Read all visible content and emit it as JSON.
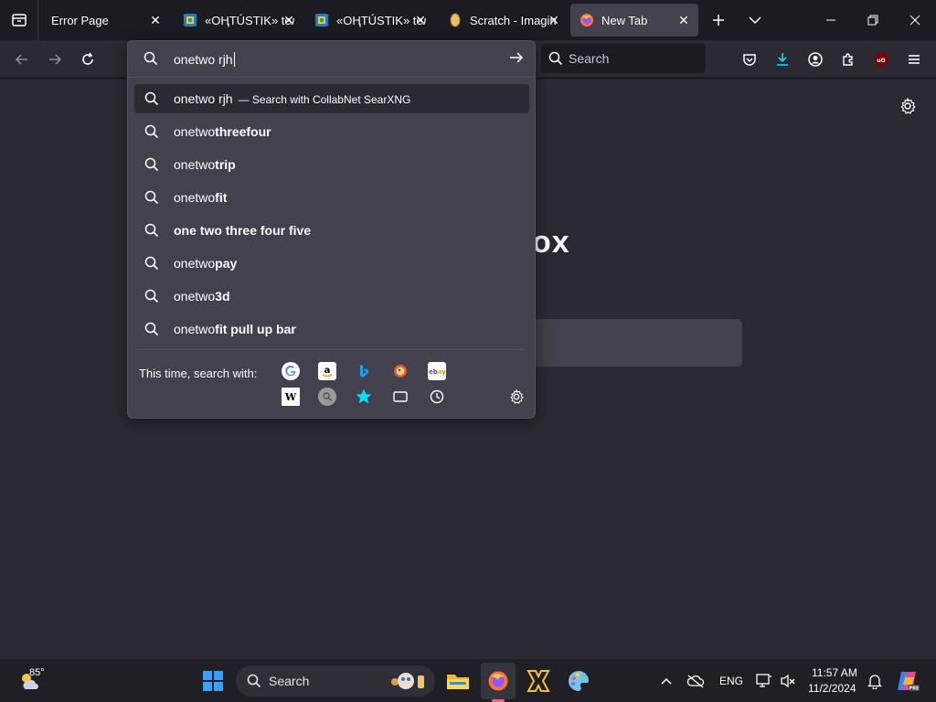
{
  "tabs": [
    {
      "title": "Error Page",
      "favicon": "none",
      "active": false
    },
    {
      "title": "«ОҢТÚSTIK» teл",
      "favicon": "site-icon",
      "active": false
    },
    {
      "title": "«ОҢТÚSTIK» teл",
      "favicon": "site-icon",
      "active": false
    },
    {
      "title": "Scratch - Imagin",
      "favicon": "scratch-icon",
      "active": false
    },
    {
      "title": "New Tab",
      "favicon": "firefox-icon",
      "active": true
    }
  ],
  "toolbar": {
    "search_label": "Search"
  },
  "urlbar": {
    "value": "onetwo rjh"
  },
  "results": [
    {
      "normal": "onetwo rjh",
      "bold": "",
      "action": "— Search with CollabNet SearXNG"
    },
    {
      "normal": "onetwo",
      "bold": "threefour",
      "action": ""
    },
    {
      "normal": "onetwo",
      "bold": "trip",
      "action": ""
    },
    {
      "normal": "onetwo",
      "bold": "fit",
      "action": ""
    },
    {
      "normal": "",
      "bold": "one two three four five",
      "action": ""
    },
    {
      "normal": "onetwo",
      "bold": "pay",
      "action": ""
    },
    {
      "normal": "onetwo",
      "bold": "3d",
      "action": ""
    },
    {
      "normal": "onetwo",
      "bold": "fit pull up bar",
      "action": ""
    }
  ],
  "oneoff": {
    "label": "This time, search with:",
    "engines": [
      "google-icon",
      "amazon-icon",
      "bing-icon",
      "duckduckgo-icon",
      "ebay-icon",
      "wikipedia-icon",
      "searx-icon",
      "bookmarks-icon",
      "tabs-icon",
      "history-icon"
    ]
  },
  "page": {
    "brand_fragment": "ox"
  },
  "taskbar": {
    "weather_temp": "85°",
    "search_label": "Search",
    "language": "ENG",
    "time": "11:57 AM",
    "date": "11/2/2024"
  },
  "colors": {
    "accent_download": "#00ddff",
    "ublock_red": "#800000"
  }
}
